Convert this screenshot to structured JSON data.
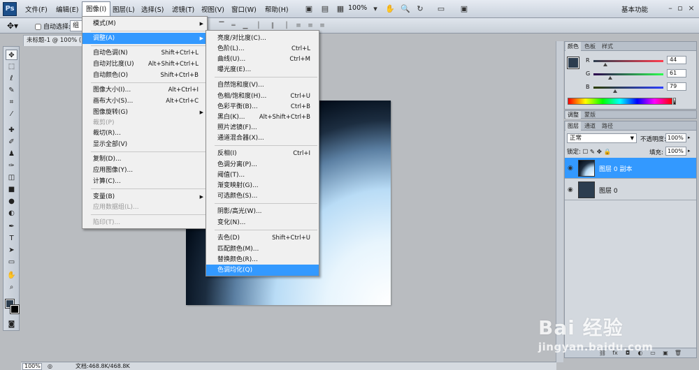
{
  "app": {
    "logo": "Ps",
    "workspace": "基本功能",
    "zoom": "100%"
  },
  "menubar": {
    "items": [
      "文件(F)",
      "编辑(E)",
      "图像(I)",
      "图层(L)",
      "选择(S)",
      "滤镜(T)",
      "视图(V)",
      "窗口(W)",
      "帮助(H)"
    ]
  },
  "optionsbar": {
    "auto_select": "自动选择:",
    "group": "组"
  },
  "document": {
    "tab": "未标题-1 @ 100% (图"
  },
  "image_menu": {
    "items": [
      {
        "label": "模式(M)",
        "shortcut": "",
        "submenu": true
      },
      {
        "label": "调整(A)",
        "shortcut": "",
        "submenu": true,
        "highlight": true
      },
      {
        "label": "自动色调(N)",
        "shortcut": "Shift+Ctrl+L"
      },
      {
        "label": "自动对比度(U)",
        "shortcut": "Alt+Shift+Ctrl+L"
      },
      {
        "label": "自动颜色(O)",
        "shortcut": "Shift+Ctrl+B"
      },
      {
        "label": "图像大小(I)...",
        "shortcut": "Alt+Ctrl+I"
      },
      {
        "label": "画布大小(S)...",
        "shortcut": "Alt+Ctrl+C"
      },
      {
        "label": "图像旋转(G)",
        "shortcut": "",
        "submenu": true
      },
      {
        "label": "裁剪(P)",
        "shortcut": "",
        "disabled": true
      },
      {
        "label": "裁切(R)...",
        "shortcut": ""
      },
      {
        "label": "显示全部(V)",
        "shortcut": ""
      },
      {
        "label": "复制(D)...",
        "shortcut": ""
      },
      {
        "label": "应用图像(Y)...",
        "shortcut": ""
      },
      {
        "label": "计算(C)...",
        "shortcut": ""
      },
      {
        "label": "变量(B)",
        "shortcut": "",
        "submenu": true
      },
      {
        "label": "应用数据组(L)...",
        "shortcut": "",
        "disabled": true
      },
      {
        "label": "陷印(T)...",
        "shortcut": "",
        "disabled": true
      }
    ]
  },
  "adjust_menu": {
    "items": [
      {
        "label": "亮度/对比度(C)...",
        "shortcut": ""
      },
      {
        "label": "色阶(L)...",
        "shortcut": "Ctrl+L"
      },
      {
        "label": "曲线(U)...",
        "shortcut": "Ctrl+M"
      },
      {
        "label": "曝光度(E)...",
        "shortcut": ""
      },
      {
        "label": "自然饱和度(V)...",
        "shortcut": ""
      },
      {
        "label": "色相/饱和度(H)...",
        "shortcut": "Ctrl+U"
      },
      {
        "label": "色彩平衡(B)...",
        "shortcut": "Ctrl+B"
      },
      {
        "label": "黑白(K)...",
        "shortcut": "Alt+Shift+Ctrl+B"
      },
      {
        "label": "照片滤镜(F)...",
        "shortcut": ""
      },
      {
        "label": "通道混合器(X)...",
        "shortcut": ""
      },
      {
        "label": "反相(I)",
        "shortcut": "Ctrl+I"
      },
      {
        "label": "色调分离(P)...",
        "shortcut": ""
      },
      {
        "label": "阈值(T)...",
        "shortcut": ""
      },
      {
        "label": "渐变映射(G)...",
        "shortcut": ""
      },
      {
        "label": "可选颜色(S)...",
        "shortcut": ""
      },
      {
        "label": "阴影/高光(W)...",
        "shortcut": ""
      },
      {
        "label": "变化(N)...",
        "shortcut": ""
      },
      {
        "label": "去色(D)",
        "shortcut": "Shift+Ctrl+U"
      },
      {
        "label": "匹配颜色(M)...",
        "shortcut": ""
      },
      {
        "label": "替换颜色(R)...",
        "shortcut": ""
      },
      {
        "label": "色调均化(Q)",
        "shortcut": "",
        "highlight": true
      }
    ]
  },
  "color_panel": {
    "tabs": [
      "颜色",
      "色板",
      "样式"
    ],
    "r_label": "R",
    "g_label": "G",
    "b_label": "B",
    "r": "44",
    "g": "61",
    "b": "79",
    "foreground": "#2c3d4f",
    "background": "#000000"
  },
  "adjust_panel": {
    "tabs": [
      "调整",
      "蒙版"
    ]
  },
  "layers_panel": {
    "tabs": [
      "图层",
      "通道",
      "路径"
    ],
    "blend_mode": "正常",
    "opacity_label": "不透明度:",
    "opacity": "100%",
    "lock_label": "锁定:",
    "fill_label": "填充:",
    "fill": "100%",
    "layers": [
      {
        "name": "图层 0 副本",
        "selected": true
      },
      {
        "name": "图层 0",
        "selected": false
      }
    ]
  },
  "statusbar": {
    "zoom": "100%",
    "doc": "文档:468.8K/468.8K"
  },
  "watermark": {
    "brand": "Bai 经验",
    "url": "jingyan.baidu.com"
  }
}
